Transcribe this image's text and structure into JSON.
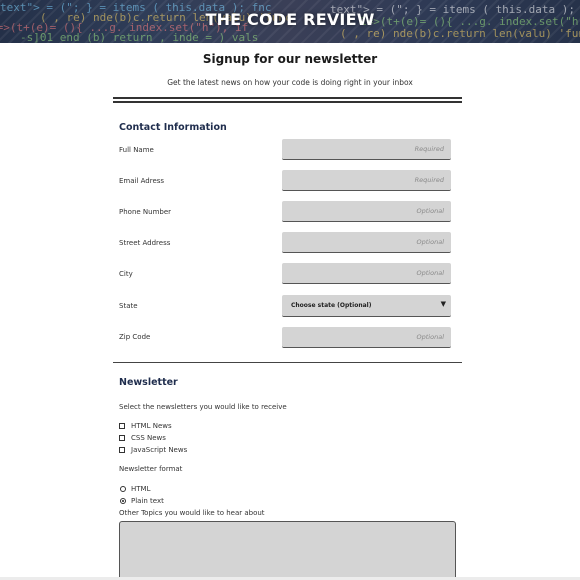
{
  "banner": {
    "title": "THE CODE REVIEW",
    "code_lines": [
      "text\"> = (\"; } = items  ( this.data ); fnc",
      "( , re) nde(b)c.return len(valu) 'func",
      "1=>(t+(e)= (){ ...g. index.set(\"h\"), if",
      "-s]01 end (b) return , inde =  ) vals"
    ]
  },
  "page": {
    "title": "Signup for our newsletter",
    "subtitle": "Get the latest news on how your code is doing right in your inbox"
  },
  "contact": {
    "heading": "Contact Information",
    "fields": [
      {
        "label": "Full Name",
        "placeholder": "Required",
        "value": ""
      },
      {
        "label": "Email Adress",
        "placeholder": "Required",
        "value": ""
      },
      {
        "label": "Phone Number",
        "placeholder": "Optional",
        "value": ""
      },
      {
        "label": "Street Address",
        "placeholder": "Optional",
        "value": ""
      },
      {
        "label": "City",
        "placeholder": "Optional",
        "value": ""
      }
    ],
    "state": {
      "label": "State",
      "selected": "Choose state (Optional)",
      "arrow": "▼"
    },
    "zip": {
      "label": "Zip Code",
      "placeholder": "Optional",
      "value": ""
    }
  },
  "newsletter": {
    "heading": "Newsletter",
    "prompt": "Select the newsletters you would like to receive",
    "options": [
      {
        "label": "HTML News",
        "checked": false
      },
      {
        "label": "CSS News",
        "checked": false
      },
      {
        "label": "JavaScript News",
        "checked": false
      }
    ],
    "format_label": "Newsletter format",
    "formats": [
      {
        "label": "HTML",
        "checked": false
      },
      {
        "label": "Plain text",
        "checked": true
      }
    ],
    "topics_label": "Other Topics you would like to hear about",
    "topics_value": ""
  },
  "colors": {
    "banner_bg": "#2f3d58",
    "heading": "#1f2d4d",
    "input_bg": "#d4d4d4",
    "code_colors": [
      "#7fd4ff",
      "#ffd966",
      "#ff7f7f",
      "#9be37f",
      "#ffffff"
    ]
  }
}
